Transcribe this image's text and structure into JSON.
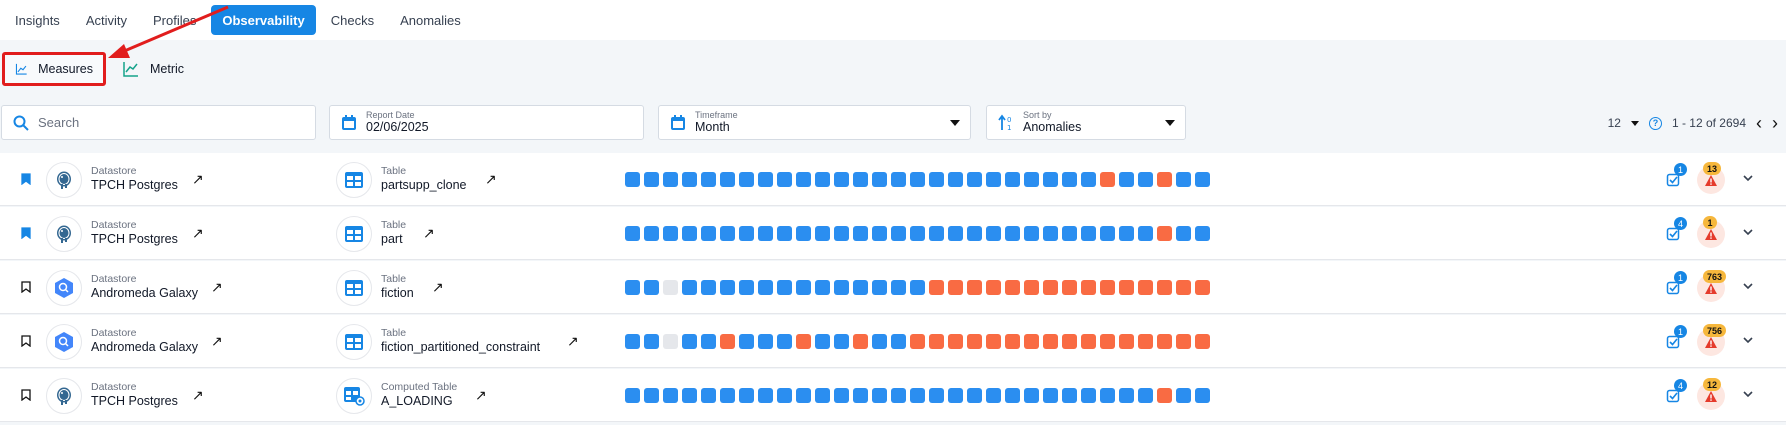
{
  "tabs": [
    {
      "label": "Insights",
      "active": false
    },
    {
      "label": "Activity",
      "active": false
    },
    {
      "label": "Profiles",
      "active": false
    },
    {
      "label": "Observability",
      "active": true
    },
    {
      "label": "Checks",
      "active": false
    },
    {
      "label": "Anomalies",
      "active": false
    }
  ],
  "subtabs": {
    "measures": "Measures",
    "metric": "Metric"
  },
  "filters": {
    "search_placeholder": "Search",
    "report_date": {
      "label": "Report Date",
      "value": "02/06/2025"
    },
    "timeframe": {
      "label": "Timeframe",
      "value": "Month"
    },
    "sort_by": {
      "label": "Sort by",
      "value": "Anomalies"
    }
  },
  "pagination": {
    "page_size": "12",
    "range": "1 - 12 of 2694"
  },
  "colors": {
    "accent": "#1686e4",
    "ok": "#2b8ef0",
    "anomaly": "#f96b43",
    "empty": "#e5e7eb",
    "highlight": "#e11d1d"
  },
  "rows": [
    {
      "bookmarked": true,
      "ds_kind": "Datastore",
      "datastore": "TPCH Postgres",
      "ds_icon": "postgres-elephant-icon",
      "table_kind": "Table",
      "table": "partsupp_clone",
      "computed": false,
      "pattern": "bbbbbbbbbbbbbbbbbbbbbbbbbrbbrbb",
      "checks": "1",
      "anomalies": "13"
    },
    {
      "bookmarked": true,
      "ds_kind": "Datastore",
      "datastore": "TPCH Postgres",
      "ds_icon": "postgres-elephant-icon",
      "table_kind": "Table",
      "table": "part",
      "computed": false,
      "pattern": "bbbbbbbbbbbbbbbbbbbbbbbbbbbbrbb",
      "checks": "4",
      "anomalies": "1"
    },
    {
      "bookmarked": false,
      "ds_kind": "Datastore",
      "datastore": "Andromeda Galaxy",
      "ds_icon": "bigquery-hexagon-icon",
      "table_kind": "Table",
      "table": "fiction",
      "computed": false,
      "pattern": "bbgbbbbbbbbbbbbbrrrrrrrrrrrrrrr",
      "checks": "1",
      "anomalies": "763"
    },
    {
      "bookmarked": false,
      "ds_kind": "Datastore",
      "datastore": "Andromeda Galaxy",
      "ds_icon": "bigquery-hexagon-icon",
      "table_kind": "Table",
      "table": "fiction_partitioned_constraint",
      "computed": false,
      "pattern": "bbgbbrbbbrbbrbbrrrrrrrrrrrrrrrr",
      "checks": "1",
      "anomalies": "756"
    },
    {
      "bookmarked": false,
      "ds_kind": "Datastore",
      "datastore": "TPCH Postgres",
      "ds_icon": "postgres-elephant-icon",
      "table_kind": "Computed Table",
      "table": "A_LOADING",
      "computed": true,
      "pattern": "bbbbbbbbbbbbbbbbbbbbbbbbbbbbrbb",
      "checks": "4",
      "anomalies": "12"
    }
  ]
}
